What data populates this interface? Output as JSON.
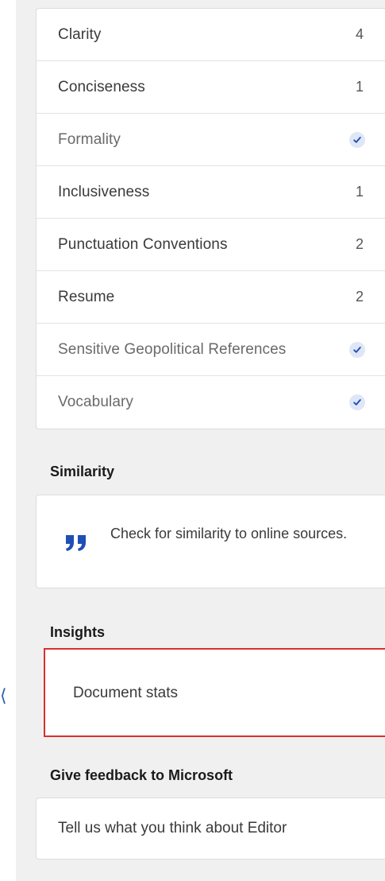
{
  "refine_list": [
    {
      "label": "Clarity",
      "count": "4",
      "done": false,
      "muted": false
    },
    {
      "label": "Conciseness",
      "count": "1",
      "done": false,
      "muted": false
    },
    {
      "label": "Formality",
      "count": "",
      "done": true,
      "muted": true
    },
    {
      "label": "Inclusiveness",
      "count": "1",
      "done": false,
      "muted": false
    },
    {
      "label": "Punctuation Conventions",
      "count": "2",
      "done": false,
      "muted": false
    },
    {
      "label": "Resume",
      "count": "2",
      "done": false,
      "muted": false
    },
    {
      "label": "Sensitive Geopolitical References",
      "count": "",
      "done": true,
      "muted": true
    },
    {
      "label": "Vocabulary",
      "count": "",
      "done": true,
      "muted": true
    }
  ],
  "similarity": {
    "heading": "Similarity",
    "text": "Check for similarity to online sources.",
    "icon": "quote-icon"
  },
  "insights": {
    "heading": "Insights",
    "item": "Document stats"
  },
  "feedback": {
    "heading": "Give feedback to Microsoft",
    "item": "Tell us what you think about Editor"
  },
  "colors": {
    "accent": "#1f4fb5",
    "highlight_border": "#d8302a",
    "check_bg": "#dfe6f7"
  }
}
